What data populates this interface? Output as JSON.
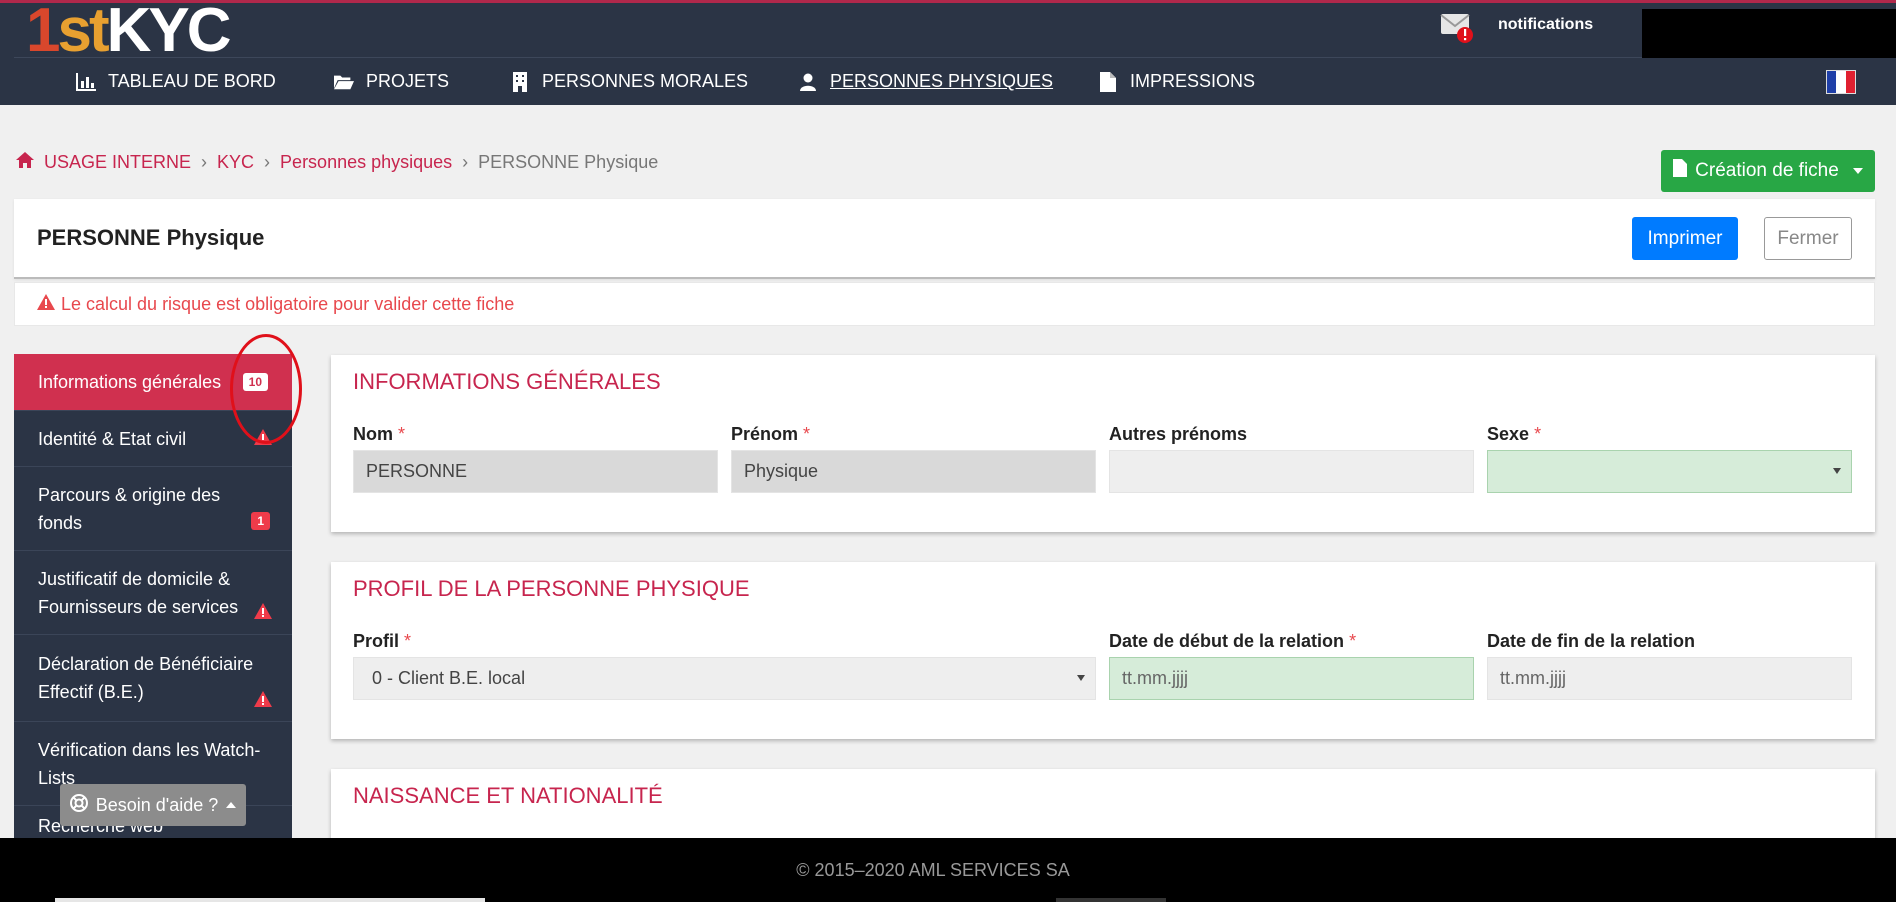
{
  "app": {
    "logo": {
      "part1": "1",
      "part2": "st",
      "part3": "KYC"
    }
  },
  "topbar": {
    "notifications_label": "notifications",
    "notifications_icon": "mail-alert-icon"
  },
  "nav": {
    "items": [
      {
        "label": "TABLEAU DE BORD",
        "icon": "bar-chart-icon"
      },
      {
        "label": "PROJETS",
        "icon": "folder-open-icon"
      },
      {
        "label": "PERSONNES MORALES",
        "icon": "building-icon"
      },
      {
        "label": "PERSONNES PHYSIQUES",
        "icon": "user-icon",
        "active": true
      },
      {
        "label": "IMPRESSIONS",
        "icon": "file-icon"
      }
    ],
    "language_flag": "fr-flag-icon"
  },
  "breadcrumb": {
    "home": "USAGE INTERNE",
    "level2": "KYC",
    "level3": "Personnes physiques",
    "current": "PERSONNE Physique"
  },
  "create_button": {
    "label": "Création de fiche"
  },
  "header": {
    "title": "PERSONNE Physique",
    "print_label": "Imprimer",
    "close_label": "Fermer"
  },
  "alert": {
    "text": "Le calcul du risque est obligatoire pour valider cette fiche"
  },
  "sidenav": {
    "items": [
      {
        "label": "Informations générales",
        "badge": "10",
        "active": true
      },
      {
        "label": "Identité & Etat civil",
        "warn": true
      },
      {
        "label": "Parcours & origine des fonds",
        "badge": "1"
      },
      {
        "label": "Justificatif de domicile & Fournisseurs de services",
        "warn": true
      },
      {
        "label": "Déclaration de Bénéficiaire Effectif (B.E.)",
        "warn": true
      },
      {
        "label": "Vérification dans les Watch-Lists"
      },
      {
        "label": "Recherche web"
      }
    ]
  },
  "help": {
    "label": "Besoin d'aide ?"
  },
  "sections": {
    "general": {
      "title": "INFORMATIONS GÉNÉRALES",
      "nom_label": "Nom",
      "nom_value": "PERSONNE",
      "prenom_label": "Prénom",
      "prenom_value": "Physique",
      "autres_label": "Autres prénoms",
      "autres_value": "",
      "sexe_label": "Sexe",
      "sexe_value": ""
    },
    "profil": {
      "title": "PROFIL DE LA PERSONNE PHYSIQUE",
      "profil_label": "Profil",
      "profil_value": "0 - Client B.E. local",
      "debut_label": "Date de début de la relation",
      "debut_placeholder": "tt.mm.jjjj",
      "fin_label": "Date de fin de la relation",
      "fin_placeholder": "tt.mm.jjjj"
    },
    "naissance": {
      "title": "NAISSANCE ET NATIONALITÉ"
    }
  },
  "footer": {
    "text": "© 2015–2020 AML SERVICES SA"
  },
  "colors": {
    "accent": "#c7254e",
    "navbar": "#2b3445",
    "success": "#28a745",
    "primary": "#007bff"
  }
}
